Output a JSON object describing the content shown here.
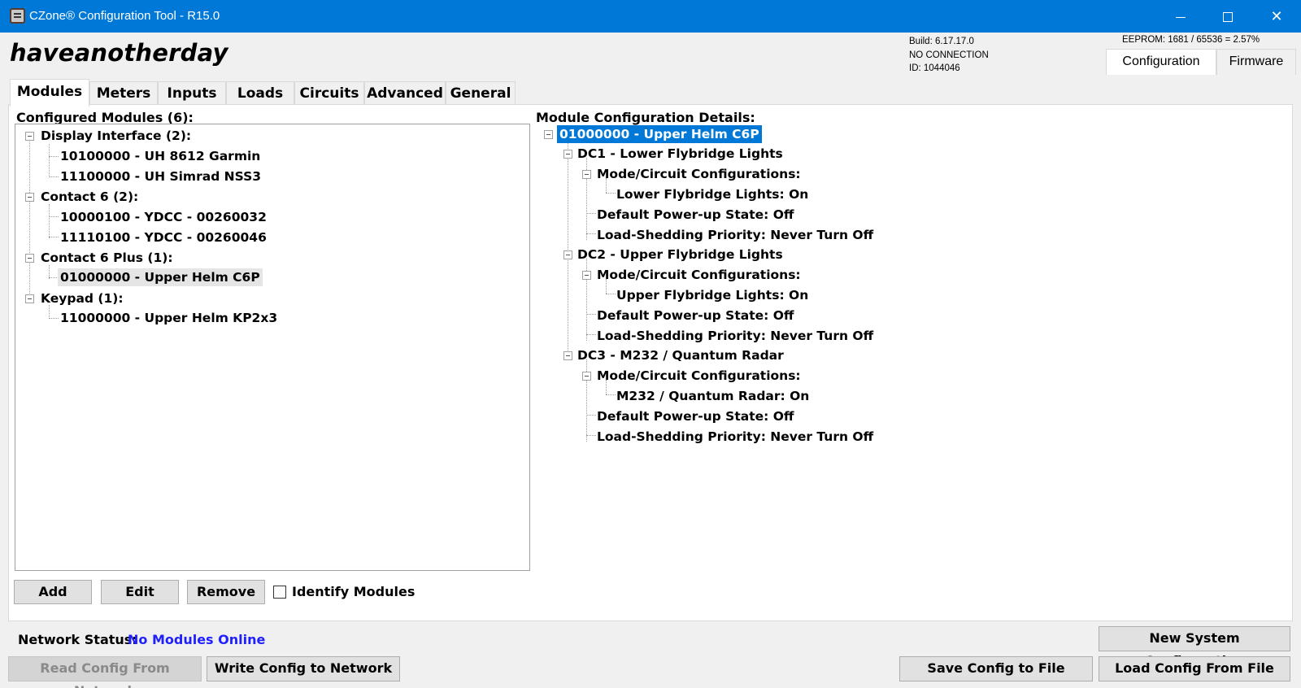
{
  "window": {
    "title": "CZone® Configuration Tool - R15.0",
    "minimize_icon": "minimize-icon",
    "maximize_icon": "maximize-icon",
    "close_glyph": "✕"
  },
  "header": {
    "system_name": "haveanotherday",
    "build": "Build: 6.17.17.0",
    "connection": "NO CONNECTION",
    "id": "ID: 1044046",
    "eeprom": "EEPROM: 1681 / 65536 = 2.57%",
    "mode_tabs": [
      {
        "label": "Configuration",
        "active": true
      },
      {
        "label": "Firmware",
        "active": false
      }
    ]
  },
  "tabs": [
    {
      "label": "Modules",
      "active": true
    },
    {
      "label": "Meters",
      "active": false
    },
    {
      "label": "Inputs",
      "active": false
    },
    {
      "label": "Loads",
      "active": false
    },
    {
      "label": "Circuits",
      "active": false
    },
    {
      "label": "Advanced",
      "active": false
    },
    {
      "label": "General",
      "active": false
    }
  ],
  "modules_panel": {
    "title": "Configured Modules (6):",
    "groups": [
      {
        "label": "Display Interface (2):",
        "items": [
          "10100000 - UH 8612 Garmin",
          "11100000 - UH Simrad NSS3"
        ]
      },
      {
        "label": "Contact 6 (2):",
        "items": [
          "10000100 - YDCC - 00260032",
          "11110100 - YDCC - 00260046"
        ]
      },
      {
        "label": "Contact 6 Plus (1):",
        "items": [
          "01000000 - Upper Helm C6P"
        ]
      },
      {
        "label": "Keypad (1):",
        "items": [
          "11000000 - Upper Helm KP2x3"
        ]
      }
    ],
    "selected_item": "01000000 - Upper Helm C6P"
  },
  "details_panel": {
    "title": "Module Configuration Details:",
    "root": "01000000 - Upper Helm C6P",
    "circuits": [
      {
        "label": "DC1 - Lower Flybridge Lights",
        "mode_header": "Mode/Circuit Configurations:",
        "mode_value": "Lower Flybridge Lights: On",
        "power_up": "Default Power-up State: Off",
        "load_shed": "Load-Shedding Priority: Never Turn Off"
      },
      {
        "label": "DC2 - Upper Flybridge Lights",
        "mode_header": "Mode/Circuit Configurations:",
        "mode_value": "Upper Flybridge Lights: On",
        "power_up": "Default Power-up State: Off",
        "load_shed": "Load-Shedding Priority: Never Turn Off"
      },
      {
        "label": "DC3 - M232 / Quantum Radar",
        "mode_header": "Mode/Circuit Configurations:",
        "mode_value": "M232 / Quantum Radar: On",
        "power_up": "Default Power-up State: Off",
        "load_shed": "Load-Shedding Priority: Never Turn Off"
      }
    ]
  },
  "actions": {
    "add": "Add",
    "edit": "Edit",
    "remove": "Remove",
    "identify_modules": "Identify Modules",
    "identify_checked": false
  },
  "footer": {
    "network_status_label": "Network Status:",
    "network_status_value": "No Modules Online",
    "new_system_configuration": "New System Configuration",
    "read_config": "Read Config From Network",
    "write_config": "Write Config to Network",
    "save_config": "Save Config to File",
    "load_config": "Load Config From File"
  },
  "colors": {
    "titlebar": "#0078d7",
    "selection": "#0078d7",
    "status_text": "#1f1fff"
  }
}
